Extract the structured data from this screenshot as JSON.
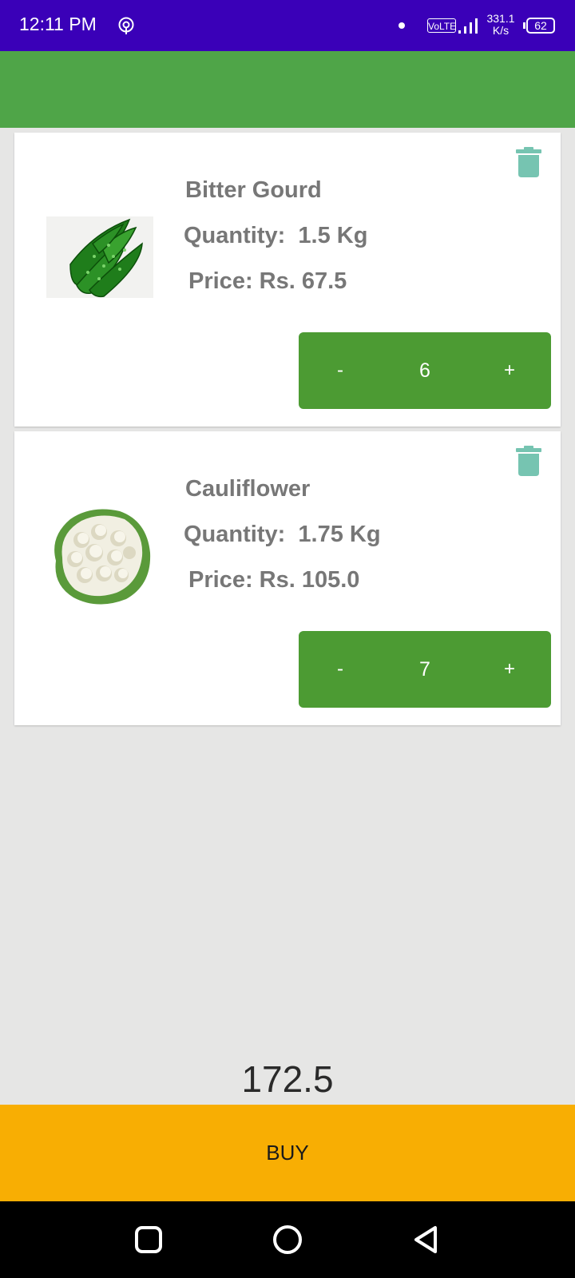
{
  "status_bar": {
    "time": "12:11 PM",
    "volte": "VoLTE",
    "speed_value": "331.1",
    "speed_unit": "K/s",
    "battery": "62"
  },
  "cart": {
    "items": [
      {
        "name": "Bitter Gourd",
        "quantity": "Quantity:  1.5 Kg",
        "price": "Price: Rs. 67.5",
        "count": "6",
        "minus": "-",
        "plus": "+"
      },
      {
        "name": "Cauliflower",
        "quantity": "Quantity:  1.75 Kg",
        "price": "Price: Rs. 105.0",
        "count": "7",
        "minus": "-",
        "plus": "+"
      }
    ]
  },
  "total": "172.5",
  "buy_label": "BUY",
  "colors": {
    "status_bar": "#3a00b8",
    "app_bar": "#4fa548",
    "stepper": "#4c9b33",
    "delete_icon": "#76c4b1",
    "buy_button": "#f8ae03"
  },
  "icons": [
    "hotspot-icon",
    "signal-icon",
    "battery-icon",
    "delete-icon",
    "nav-recents-icon",
    "nav-home-icon",
    "nav-back-icon"
  ]
}
